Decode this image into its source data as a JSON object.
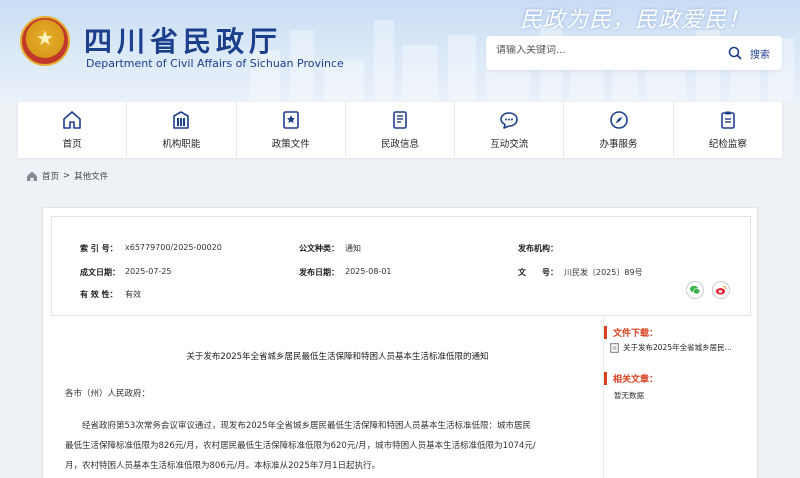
{
  "header": {
    "org_name_cn": "四川省民政厅",
    "org_name_en": "Department of Civil Affairs of Sichuan Province",
    "slogan": "民政为民，民政爱民！",
    "search": {
      "placeholder": "请输入关键词...",
      "button_label": "搜索"
    }
  },
  "nav": [
    {
      "label": "首页",
      "icon": "home-icon"
    },
    {
      "label": "机构职能",
      "icon": "building-icon"
    },
    {
      "label": "政策文件",
      "icon": "document-icon"
    },
    {
      "label": "民政信息",
      "icon": "book-icon"
    },
    {
      "label": "互动交流",
      "icon": "chat-icon"
    },
    {
      "label": "办事服务",
      "icon": "compass-icon"
    },
    {
      "label": "纪检监察",
      "icon": "clipboard-icon"
    }
  ],
  "breadcrumb": {
    "home": "首页",
    "separator": ">",
    "current": "其他文件"
  },
  "meta": {
    "index_no_label": "索 引 号：",
    "index_no": "x65779700/2025-00020",
    "category_label": "公文种类：",
    "category": "通知",
    "issuer_label": "发布机构：",
    "issuer": "",
    "written_date_label": "成文日期：",
    "written_date": "2025-07-25",
    "publish_date_label": "发布日期：",
    "publish_date": "2025-08-01",
    "doc_no_label": "文　　号：",
    "doc_no": "川民发〔2025〕89号",
    "validity_label": "有 效 性：",
    "validity": "有效"
  },
  "share": {
    "wechat_icon": "wechat-icon",
    "weibo_icon": "weibo-icon"
  },
  "article": {
    "title": "关于发布2025年全省城乡居民最低生活保障和特困人员基本生活标准低限的通知",
    "salutation": "各市（州）人民政府：",
    "paragraph_lines": [
      "　　经省政府第53次常务会议审议通过，现发布2025年全省城乡居民最低生活保障和特困人员基本生活标准低限：城市居民",
      "最低生活保障标准低限为826元/月，农村居民最低生活保障标准低限为620元/月，城市特困人员基本生活标准低限为1074元/",
      "月，农村特困人员基本生活标准低限为806元/月。本标准从2025年7月1日起执行。"
    ]
  },
  "sidebar": {
    "downloads_heading": "文件下载：",
    "download_file": "关于发布2025年全省城乡居民...",
    "related_heading": "相关文章：",
    "related_empty": "暂无数据"
  },
  "colors": {
    "brand_blue": "#1c3f8c",
    "accent_orange": "#d8401f"
  }
}
